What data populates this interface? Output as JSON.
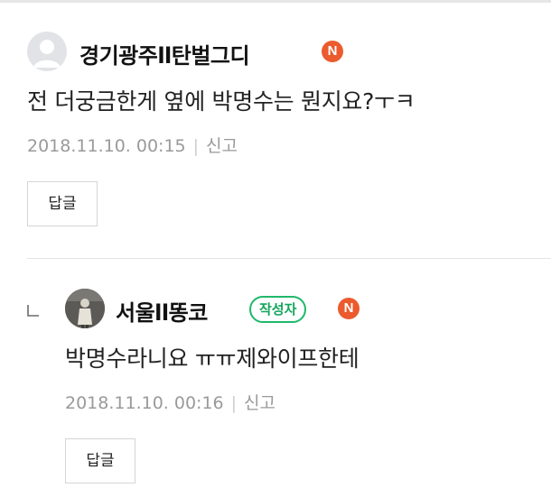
{
  "comments": [
    {
      "username": "경기광주ll탄벌그디",
      "badge": "N",
      "text": "전 더궁금한게 옆에 박명수는 뭔지요?ㅜㅋ",
      "date": "2018.11.10. 00:15",
      "separator": "|",
      "report": "신고",
      "reply_button": "답글",
      "avatar": "default-profile-icon"
    },
    {
      "username": "서울ll똥코",
      "author_badge": "작성자",
      "badge": "N",
      "text": "박명수라니요 ㅠㅠ제와이프한테",
      "date": "2018.11.10. 00:16",
      "separator": "|",
      "report": "신고",
      "reply_button": "답글",
      "avatar": "profile-photo"
    }
  ],
  "colors": {
    "naver_badge": "#eb5b2e",
    "author_badge": "#20b86a",
    "meta_text": "#9a9a9a"
  }
}
